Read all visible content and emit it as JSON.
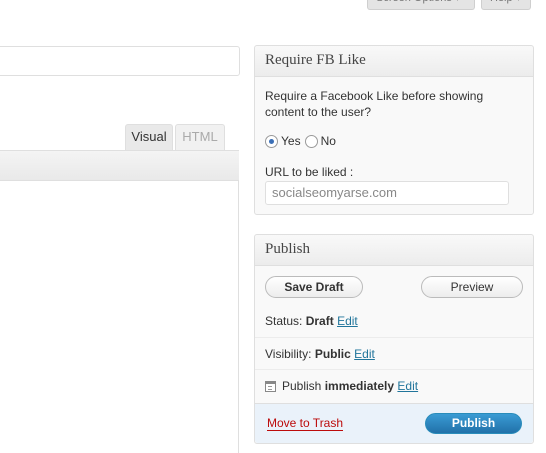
{
  "top_tabs": {
    "screen_options": "Screen Options ▾",
    "help": "Help ▾"
  },
  "editor": {
    "tabs": {
      "visual": "Visual",
      "html": "HTML"
    }
  },
  "fb_box": {
    "title": "Require FB Like",
    "description": "Require a Facebook Like before showing content to the user?",
    "options": {
      "yes": "Yes",
      "no": "No"
    },
    "selected": "yes",
    "url_label": "URL to be liked :",
    "url_value": "socialseomyarse.com"
  },
  "publish_box": {
    "title": "Publish",
    "save_draft": "Save Draft",
    "preview": "Preview",
    "status_label": "Status:",
    "status_value": "Draft",
    "visibility_label": "Visibility:",
    "visibility_value": "Public",
    "publish_label": "Publish",
    "publish_value": "immediately",
    "edit": "Edit",
    "trash": "Move to Trash",
    "publish_button": "Publish"
  },
  "colors": {
    "link": "#21759b",
    "trash": "#bc0b0b",
    "publish_button": "#2171a9"
  }
}
